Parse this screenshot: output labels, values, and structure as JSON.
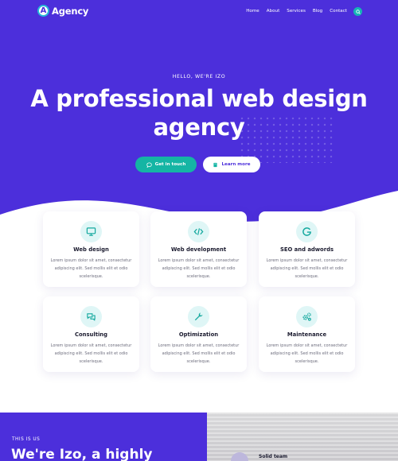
{
  "brand": {
    "logo_letter": "A",
    "name": "Agency"
  },
  "nav": {
    "items": [
      "Home",
      "About",
      "Services",
      "Blog",
      "Contact"
    ]
  },
  "hero": {
    "eyebrow": "HELLO, WE'RE IZO",
    "headline_line1": "A professional web design",
    "headline_line2": "agency",
    "primary_button": "Get in touch",
    "secondary_button": "Learn more"
  },
  "services": [
    {
      "icon": "monitor-icon",
      "title": "Web design",
      "text": "Lorem ipsum dolor sit amet, consectetur adipiscing elit. Sed mollis elit et odio scelerisque."
    },
    {
      "icon": "code-icon",
      "title": "Web development",
      "text": "Lorem ipsum dolor sit amet, consectetur adipiscing elit. Sed mollis elit et odio scelerisque."
    },
    {
      "icon": "google-icon",
      "title": "SEO and adwords",
      "text": "Lorem ipsum dolor sit amet, consectetur adipiscing elit. Sed mollis elit et odio scelerisque."
    },
    {
      "icon": "chat-icon",
      "title": "Consulting",
      "text": "Lorem ipsum dolor sit amet, consectetur adipiscing elit. Sed mollis elit et odio scelerisque."
    },
    {
      "icon": "wrench-icon",
      "title": "Optimization",
      "text": "Lorem ipsum dolor sit amet, consectetur adipiscing elit. Sed mollis elit et odio scelerisque."
    },
    {
      "icon": "gears-icon",
      "title": "Maintenance",
      "text": "Lorem ipsum dolor sit amet, consectetur adipiscing elit. Sed mollis elit et odio scelerisque."
    }
  ],
  "about": {
    "eyebrow": "THIS IS US",
    "heading": "We're Izo, a highly",
    "feature_label": "Solid team"
  },
  "colors": {
    "brand_purple": "#4c2fdb",
    "accent_teal": "#15b5a4",
    "icon_bg": "#dff6f6"
  }
}
